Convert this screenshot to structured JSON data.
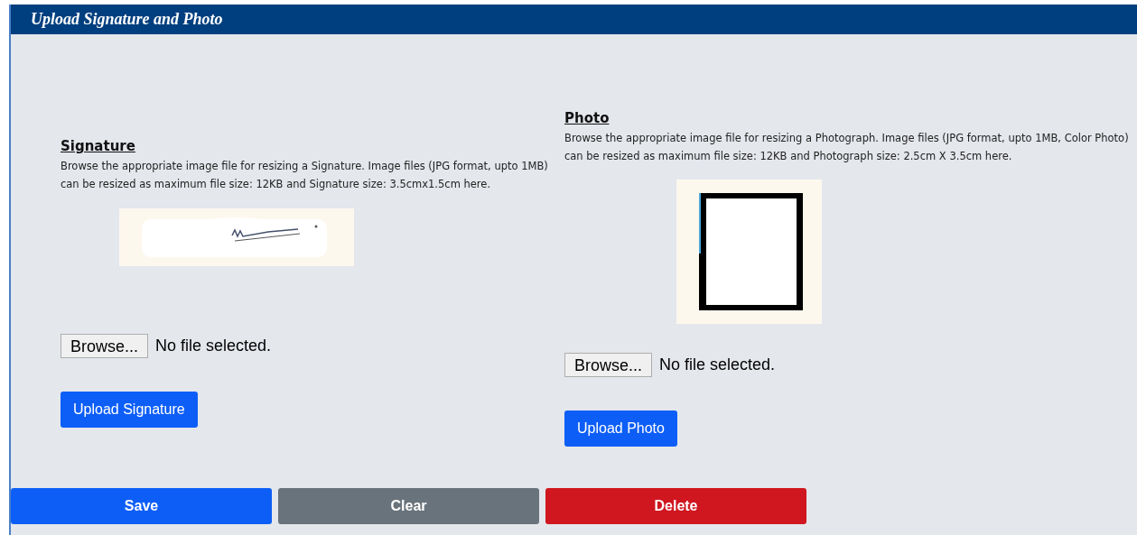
{
  "panel": {
    "title": "Upload Signature and Photo"
  },
  "sections": [
    {
      "heading": "Signature",
      "description": "Browse the appropriate image file for resizing a Signature. Image files (JPG format, upto 1MB) can be resized as maximum file size: 12KB and Signature size: 3.5cmx1.5cm here.",
      "preview": {
        "kind": "signature"
      },
      "browse_label": "Browse...",
      "file_status": "No file selected.",
      "upload_label": "Upload Signature"
    },
    {
      "heading": "Photo",
      "description": "Browse the appropriate image file for resizing a Photograph. Image files (JPG format, upto 1MB, Color Photo) can be resized as maximum file size: 12KB and Photograph size: 2.5cm X 3.5cm here.",
      "browse_label": "Browse...",
      "file_status": "No file selected.",
      "upload_label": "Upload Photo"
    }
  ],
  "actions": [
    {
      "label": "Save",
      "color": "#0d5ef7"
    },
    {
      "label": "Clear",
      "color": "#69737b"
    },
    {
      "label": "Delete",
      "color": "#d0161f"
    }
  ]
}
